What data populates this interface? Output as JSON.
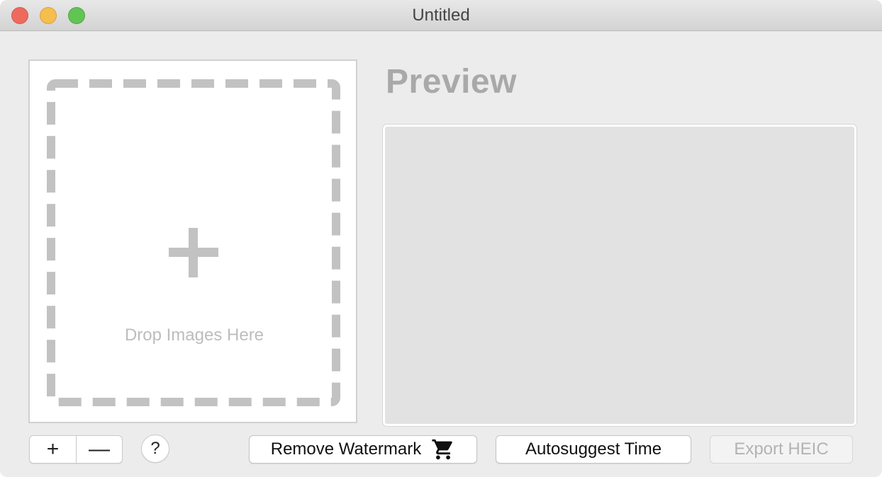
{
  "window": {
    "title": "Untitled"
  },
  "drop_area": {
    "label": "Drop Images Here",
    "icon": "plus-icon"
  },
  "preview": {
    "title": "Preview"
  },
  "toolbar": {
    "add_symbol": "+",
    "remove_symbol": "—",
    "help_symbol": "?",
    "remove_watermark_label": "Remove Watermark",
    "remove_watermark_icon": "shopping-cart-icon",
    "autosuggest_label": "Autosuggest Time",
    "export_label": "Export HEIC",
    "export_enabled": false
  },
  "colors": {
    "close": "#ee6a5f",
    "minimize": "#f5be4f",
    "zoom": "#61c454",
    "dashed_border": "#c2c2c2",
    "disabled_text": "#b3b3b3"
  }
}
